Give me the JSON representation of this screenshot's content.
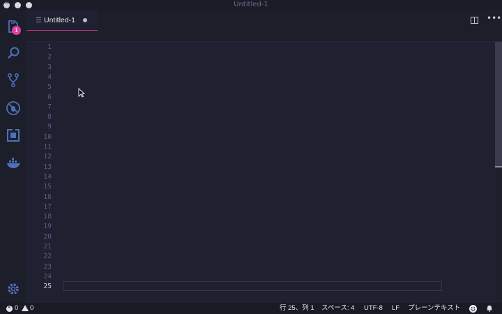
{
  "window": {
    "title": "Untitled-1"
  },
  "activity_bar": {
    "explorer_badge": "1",
    "icons": [
      "files-icon",
      "search-icon",
      "source-control-icon",
      "debug-icon",
      "extensions-icon",
      "docker-icon",
      "gear-icon"
    ]
  },
  "tabs": [
    {
      "label": "Untitled-1",
      "dirty": true
    }
  ],
  "editor": {
    "line_numbers": [
      "1",
      "2",
      "3",
      "4",
      "5",
      "6",
      "7",
      "8",
      "9",
      "10",
      "11",
      "12",
      "13",
      "14",
      "15",
      "16",
      "17",
      "18",
      "19",
      "20",
      "21",
      "22",
      "23",
      "24",
      "25"
    ],
    "current_line": "25"
  },
  "status_bar": {
    "errors": "0",
    "warnings": "0",
    "position": "行 25、列 1",
    "indent": "スペース: 4",
    "encoding": "UTF-8",
    "eol": "LF",
    "language": "プレーンテキスト"
  },
  "colors": {
    "accent": "#c0308a",
    "badge": "#e040a0",
    "background": "#1f2130",
    "line_number": "#5a5e82"
  }
}
